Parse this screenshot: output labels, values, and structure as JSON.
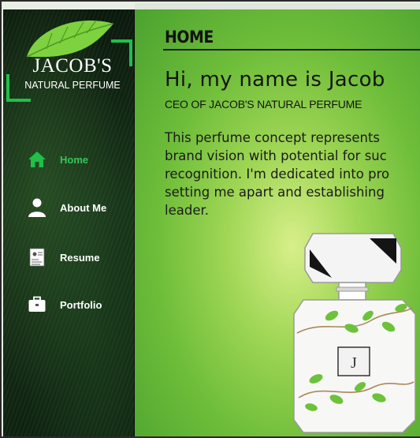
{
  "brand": {
    "name": "JACOB'S",
    "tagline": "NATURAL PERFUME",
    "accent_color": "#1fbf4a",
    "leaf_color": "#7ed23f"
  },
  "sidebar": {
    "items": [
      {
        "label": "Home",
        "icon": "home-icon",
        "active": true
      },
      {
        "label": "About Me",
        "icon": "user-icon",
        "active": false
      },
      {
        "label": "Resume",
        "icon": "resume-icon",
        "active": false
      },
      {
        "label": "Portfolio",
        "icon": "briefcase-icon",
        "active": false
      }
    ],
    "active_color": "#34c659"
  },
  "main": {
    "page_title": "HOME",
    "greeting": "Hi, my name is Jacob",
    "subtitle": "CEO OF JACOB'S NATURAL PERFUME",
    "bio_lines": [
      "This perfume concept represents",
      "brand vision with potential for suc",
      "recognition. I'm dedicated into pro",
      "setting me apart and establishing",
      "leader."
    ],
    "bottle_monogram": "J"
  }
}
